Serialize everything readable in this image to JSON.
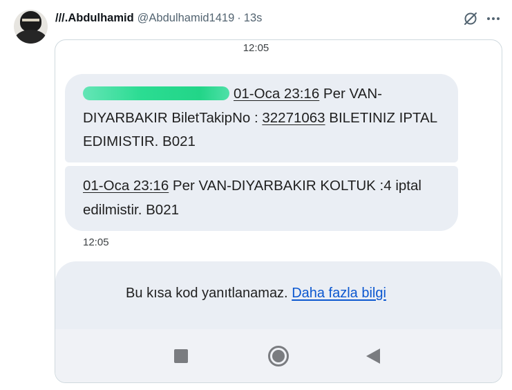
{
  "post": {
    "display_name": "///.Abdulhamid",
    "handle": "@Abdulhamid1419",
    "separator": "·",
    "time_ago": "13s",
    "icons": {
      "grok": "grok-slash-circle-icon",
      "more": "more-horizontal-icon"
    }
  },
  "sms": {
    "time_top": "12:05",
    "message1": {
      "time_link": "01-Oca 23:16",
      "text_a": " Per VAN-DIYARBAKIR BiletTakipNo : ",
      "ticket_number": "32271063",
      "text_b": " BILETINIZ IPTAL EDIMISTIR. B021"
    },
    "message2": {
      "time_link": "01-Oca 23:16",
      "text": " Per VAN-DIYARBAKIR KOLTUK :4 iptal edilmistir. B021"
    },
    "time_bottom": "12:05",
    "reply_notice": "Bu kısa kod yanıtlanamaz. ",
    "reply_link": "Daha fazla bilgi",
    "nav_icons": [
      "recents-square-icon",
      "home-circle-icon",
      "back-triangle-icon"
    ]
  },
  "colors": {
    "bubble": "#eaeef4",
    "link": "#0b57d0",
    "redaction": "#2bdc92",
    "muted": "#536471"
  }
}
